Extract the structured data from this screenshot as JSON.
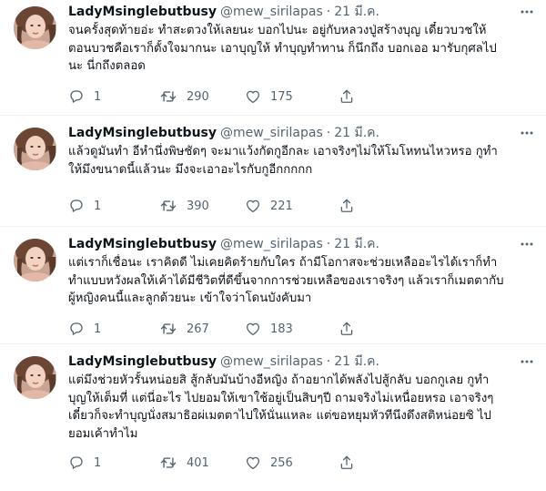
{
  "tweets": [
    {
      "name": "LadyMsinglebutbusy",
      "handle": "@mew_sirilapas",
      "separator": "·",
      "time": "21 มี.ค.",
      "lines": [
        "จนครั้งสุดท้ายอ่ะ ทำสะตวงให้เลยนะ บอกไปนะ อยู่กับหลวงปู่สร้างบุญ เดี๋ยวบวชให้",
        "ตอนบวชคือเราก็ตั้งใจมากนะ เอาบุญให้ ทำบุญทำทาน ก็นึกถึง บอกเออ มารับกุศลไป",
        "นะ นี่กถึงตลอด"
      ],
      "replies": "1",
      "retweets": "290",
      "likes": "175"
    },
    {
      "name": "LadyMsinglebutbusy",
      "handle": "@mew_sirilapas",
      "separator": "·",
      "time": "21 มี.ค.",
      "lines": [
        "แล้วดูมันทำ อีหำนึ่งพิษชัดๆ จะมาแว้งกัดกูอีกละ เอาจริงๆไม่ให้โมโหทนไหวหรอ กูทำ",
        "ให้มึงขนาดนี้แล้วนะ มึงจะเอาอะไรกับกูอีกกกกก"
      ],
      "replies": "1",
      "retweets": "390",
      "likes": "221"
    },
    {
      "name": "LadyMsinglebutbusy",
      "handle": "@mew_sirilapas",
      "separator": "·",
      "time": "21 มี.ค.",
      "lines": [
        "แต่เราก็เชื่อนะ เราคิดดี ไม่เคยคิดร้ายกับใคร ถ้ามีโอกาสจะช่วยเหลืออะไรได้เราก็ทำ",
        "ทำแบบหวังผลให้เค้าได้มีชีวิตที่ดีขึ้นจากการช่วยเหลือของเราจริงๆ แล้วเราก็เมตตากับ",
        "ผู้หญิงคนนี้และลูกด้วยนะ เข้าใจว่าโดนบังคับมา"
      ],
      "replies": "1",
      "retweets": "267",
      "likes": "183"
    },
    {
      "name": "LadyMsinglebutbusy",
      "handle": "@mew_sirilapas",
      "separator": "·",
      "time": "21 มี.ค.",
      "lines": [
        "แต่มึงช่วยหัวรั้นหน่อยสิ สู้กลับมันบ้างอีหญิง ถ้าอยากได้พลังไปสู้กลับ บอกกูเลย กูทำ",
        "บุญให้เต็มที่ แต่นี่อะไร ไปยอมให้เขาใช้อยู่เป็นสิบๆปี ถามจริงไม่เหนื่อยหรอ เอาจริงๆ",
        "เดี๋ยวก็จะทำบุญนั่งสมาธิอผ่เมตตาไปให้นั่นแหละ แต่ขอหยุมหัวทีนึงดึงสติหน่อยซิ ไป",
        "ยอมเค้าทำไม"
      ],
      "replies": "1",
      "retweets": "401",
      "likes": "256"
    }
  ],
  "icons": {
    "reply": "reply-icon",
    "retweet": "retweet-icon",
    "like": "heart-icon",
    "share": "share-icon",
    "more": "more-icon"
  },
  "colors": {
    "text": "#0f1419",
    "secondary": "#536471",
    "divider": "#eff3f4"
  }
}
